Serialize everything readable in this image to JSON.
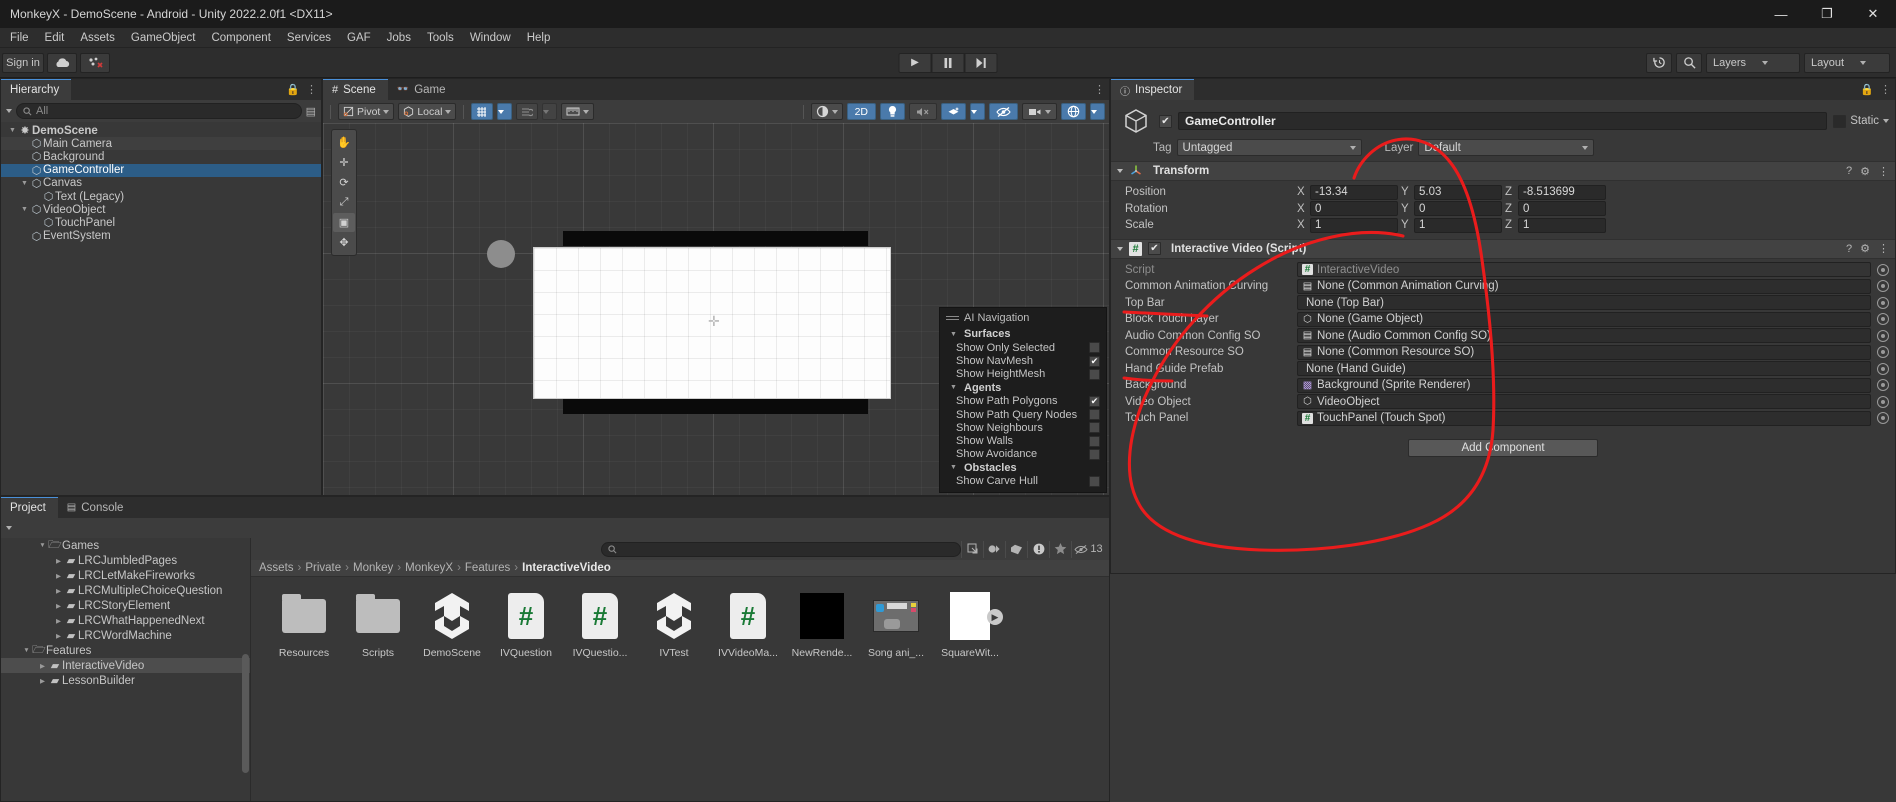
{
  "window": {
    "title": "MonkeyX - DemoScene - Android - Unity 2022.2.0f1 <DX11>",
    "minimize": "—",
    "maximize": "❐",
    "close": "✕"
  },
  "menubar": {
    "items": [
      "File",
      "Edit",
      "Assets",
      "GameObject",
      "Component",
      "Services",
      "GAF",
      "Jobs",
      "Tools",
      "Window",
      "Help"
    ]
  },
  "toolbar": {
    "account_label": "Sign in",
    "cloud_icon": "cloud-icon",
    "collab_icon": "collab-icon",
    "play": "▶",
    "pause": "▐▐",
    "step": "▶❘",
    "history_icon": "undo-history-icon",
    "search_icon": "search-icon",
    "layers_label": "Layers",
    "layout_label": "Layout"
  },
  "hierarchy": {
    "tab": "Hierarchy",
    "search_placeholder": "All",
    "add_label": "+",
    "items": [
      {
        "label": "DemoScene",
        "depth": 0,
        "expanded": true,
        "selected": false,
        "icon": "scene-icon"
      },
      {
        "label": "Main Camera",
        "depth": 1,
        "expanded": null,
        "selected": false,
        "icon": "gameobject-icon"
      },
      {
        "label": "Background",
        "depth": 1,
        "expanded": null,
        "selected": false,
        "icon": "gameobject-icon"
      },
      {
        "label": "GameController",
        "depth": 1,
        "expanded": null,
        "selected": true,
        "icon": "gameobject-icon"
      },
      {
        "label": "Canvas",
        "depth": 1,
        "expanded": true,
        "selected": false,
        "icon": "gameobject-icon"
      },
      {
        "label": "Text (Legacy)",
        "depth": 2,
        "expanded": null,
        "selected": false,
        "icon": "gameobject-icon"
      },
      {
        "label": "VideoObject",
        "depth": 1,
        "expanded": true,
        "selected": false,
        "icon": "gameobject-icon"
      },
      {
        "label": "TouchPanel",
        "depth": 2,
        "expanded": null,
        "selected": false,
        "icon": "gameobject-icon"
      },
      {
        "label": "EventSystem",
        "depth": 1,
        "expanded": null,
        "selected": false,
        "icon": "gameobject-icon"
      }
    ]
  },
  "scene": {
    "tabs": [
      {
        "label": "Scene",
        "icon": "scene-grid-icon",
        "active": true
      },
      {
        "label": "Game",
        "icon": "gamepad-icon",
        "active": false
      }
    ],
    "pivot_label": "Pivot",
    "local_label": "Local",
    "grid_icon": "grid-snap-icon",
    "snap_icon": "magnet-snap-icon",
    "ruler_icon": "ruler-icon",
    "shading_icon": "shaded-mode-icon",
    "twod_label": "2D",
    "light_icon": "lighting-icon",
    "audio_icon": "audio-mute-icon",
    "fx_icon": "effects-icon",
    "hidden_icon": "visibility-off-icon",
    "camera_icon": "scene-camera-icon",
    "gizmos_icon": "gizmos-icon"
  },
  "ai_navigation": {
    "title": "AI Navigation",
    "groups": [
      {
        "name": "Surfaces",
        "rows": [
          {
            "label": "Show Only Selected",
            "checked": false
          },
          {
            "label": "Show NavMesh",
            "checked": true
          },
          {
            "label": "Show HeightMesh",
            "checked": false
          }
        ]
      },
      {
        "name": "Agents",
        "rows": [
          {
            "label": "Show Path Polygons",
            "checked": true
          },
          {
            "label": "Show Path Query Nodes",
            "checked": false
          },
          {
            "label": "Show Neighbours",
            "checked": false
          },
          {
            "label": "Show Walls",
            "checked": false
          },
          {
            "label": "Show Avoidance",
            "checked": false
          }
        ]
      },
      {
        "name": "Obstacles",
        "rows": [
          {
            "label": "Show Carve Hull",
            "checked": false
          }
        ]
      }
    ]
  },
  "inspector": {
    "tab": "Inspector",
    "object_name": "GameController",
    "enabled": true,
    "static_label": "Static",
    "tag_label": "Tag",
    "tag_value": "Untagged",
    "layer_label": "Layer",
    "layer_value": "Default",
    "transform": {
      "title": "Transform",
      "rows": [
        {
          "label": "Position",
          "x": "-13.34",
          "y": "5.03",
          "z": "-8.513699"
        },
        {
          "label": "Rotation",
          "x": "0",
          "y": "0",
          "z": "0"
        },
        {
          "label": "Scale",
          "x": "1",
          "y": "1",
          "z": "1"
        }
      ],
      "axis_labels": [
        "X",
        "Y",
        "Z"
      ]
    },
    "script_component": {
      "title": "Interactive Video (Script)",
      "enabled": true,
      "properties": [
        {
          "label": "Script",
          "value": "InteractiveVideo",
          "icon": "cs-script-icon",
          "dim": true
        },
        {
          "label": "Common Animation Curving",
          "value": "None (Common Animation Curving)",
          "icon": "scriptable-object-icon",
          "dim": false
        },
        {
          "label": "Top Bar",
          "value": "None (Top Bar)",
          "icon": "",
          "dim": false
        },
        {
          "label": "Block Touch Layer",
          "value": "None (Game Object)",
          "icon": "gameobject-icon",
          "dim": false
        },
        {
          "label": "Audio Common Config SO",
          "value": "None (Audio Common Config SO)",
          "icon": "scriptable-object-icon",
          "dim": false
        },
        {
          "label": "Common Resource SO",
          "value": "None (Common Resource SO)",
          "icon": "scriptable-object-icon",
          "dim": false
        },
        {
          "label": "Hand Guide Prefab",
          "value": "None (Hand Guide)",
          "icon": "",
          "dim": false
        },
        {
          "label": "Background",
          "value": "Background (Sprite Renderer)",
          "icon": "sprite-renderer-icon",
          "dim": false
        },
        {
          "label": "Video Object",
          "value": "VideoObject",
          "icon": "gameobject-icon",
          "dim": false
        },
        {
          "label": "Touch Panel",
          "value": "TouchPanel (Touch Spot)",
          "icon": "cs-script-icon",
          "dim": false
        }
      ]
    },
    "add_component_label": "Add Component",
    "help_icon": "help-icon",
    "preset_icon": "preset-icon",
    "menu_icon": "kebab-menu-icon"
  },
  "project": {
    "tabs": [
      {
        "label": "Project",
        "icon": "",
        "active": true
      },
      {
        "label": "Console",
        "icon": "console-icon",
        "active": false
      }
    ],
    "create_label": "+",
    "search_placeholder": "",
    "search_icon": "search-icon",
    "filter_icons": [
      "save-search-icon",
      "asset-type-filter-icon",
      "label-filter-icon",
      "error-filter-icon",
      "favorite-filter-icon"
    ],
    "hidden_count": "13",
    "hidden_icon": "visibility-off-icon",
    "breadcrumb": [
      "Assets",
      "Private",
      "Monkey",
      "MonkeyX",
      "Features",
      "InteractiveVideo"
    ],
    "tree": [
      {
        "label": "Games",
        "depth": 2,
        "expanded": true,
        "selected": false
      },
      {
        "label": "LRCJumbledPages",
        "depth": 3,
        "expanded": false,
        "selected": false
      },
      {
        "label": "LRCLetMakeFireworks",
        "depth": 3,
        "expanded": false,
        "selected": false
      },
      {
        "label": "LRCMultipleChoiceQuestion",
        "depth": 3,
        "expanded": false,
        "selected": false
      },
      {
        "label": "LRCStoryElement",
        "depth": 3,
        "expanded": false,
        "selected": false
      },
      {
        "label": "LRCWhatHappenedNext",
        "depth": 3,
        "expanded": false,
        "selected": false
      },
      {
        "label": "LRCWordMachine",
        "depth": 3,
        "expanded": false,
        "selected": false
      },
      {
        "label": "Features",
        "depth": 1,
        "expanded": true,
        "selected": false
      },
      {
        "label": "InteractiveVideo",
        "depth": 2,
        "expanded": false,
        "selected": true
      },
      {
        "label": "LessonBuilder",
        "depth": 2,
        "expanded": false,
        "selected": false
      }
    ],
    "assets": [
      {
        "label": "Resources",
        "kind": "folder"
      },
      {
        "label": "Scripts",
        "kind": "folder"
      },
      {
        "label": "DemoScene",
        "kind": "unity-scene"
      },
      {
        "label": "IVQuestion",
        "kind": "cs-script"
      },
      {
        "label": "IVQuestio...",
        "kind": "cs-script"
      },
      {
        "label": "IVTest",
        "kind": "unity-scene"
      },
      {
        "label": "IVVideoMa...",
        "kind": "cs-script"
      },
      {
        "label": "NewRende...",
        "kind": "render-texture"
      },
      {
        "label": "Song ani_...",
        "kind": "sprite"
      },
      {
        "label": "SquareWit...",
        "kind": "white-asset"
      }
    ]
  },
  "annotation": {
    "color": "#e8141a",
    "shape": "hand-drawn-circle-and-underlines"
  }
}
